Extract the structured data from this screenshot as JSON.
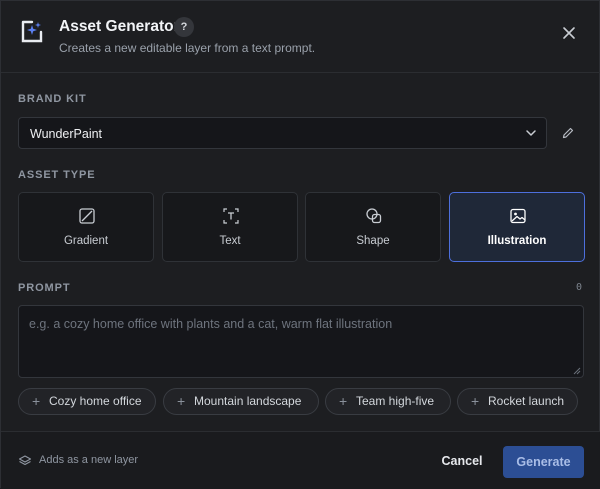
{
  "header": {
    "title": "Asset Generator",
    "help_label": "?",
    "subtitle": "Creates a new editable layer from a text prompt."
  },
  "brand_kit": {
    "label": "BRAND KIT",
    "selected": "WunderPaint"
  },
  "asset_type": {
    "label": "ASSET TYPE",
    "options": [
      {
        "label": "Gradient",
        "icon": "gradient-icon"
      },
      {
        "label": "Text",
        "icon": "text-icon"
      },
      {
        "label": "Shape",
        "icon": "shape-icon"
      },
      {
        "label": "Illustration",
        "icon": "image-icon"
      }
    ],
    "selected": "Illustration"
  },
  "prompt": {
    "label": "PROMPT",
    "char_count": "0",
    "placeholder": "e.g. a cozy home office with plants and a cat, warm flat illustration",
    "value": ""
  },
  "suggestions": [
    "Cozy home office",
    "Mountain landscape",
    "Team high-five",
    "Rocket launch"
  ],
  "footer": {
    "note": "Adds as a new layer",
    "cancel_label": "Cancel",
    "generate_label": "Generate"
  },
  "colors": {
    "accent": "#4d6fdc",
    "primary_button": "#2c4e94",
    "background": "#1d1e21"
  }
}
